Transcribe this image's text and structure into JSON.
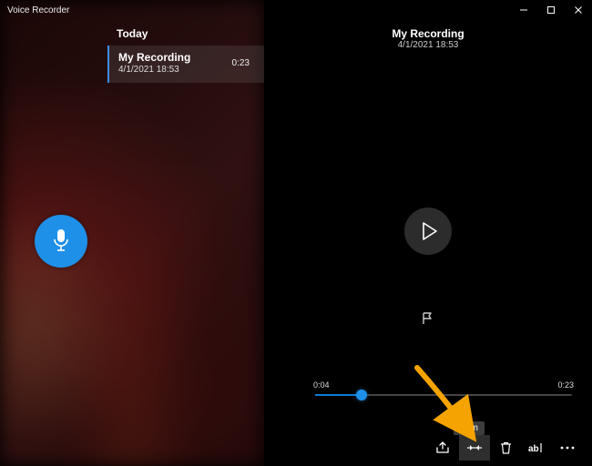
{
  "app": {
    "title": "Voice Recorder"
  },
  "window_controls": {
    "minimize_icon": "minimize-icon",
    "maximize_icon": "maximize-icon",
    "close_icon": "close-icon"
  },
  "colors": {
    "accent": "#1e90e8"
  },
  "list": {
    "section_header": "Today",
    "items": [
      {
        "title": "My Recording",
        "subtitle": "4/1/2021 18:53",
        "duration": "0:23",
        "selected": true
      }
    ]
  },
  "detail": {
    "title": "My Recording",
    "subtitle": "4/1/2021 18:53"
  },
  "timeline": {
    "current": "0:04",
    "total": "0:23",
    "progress_percent": 18
  },
  "toolbar": {
    "share_label": "Share",
    "trim_label": "Trim",
    "delete_label": "Delete",
    "rename_label": "Rename",
    "more_label": "More",
    "tooltip_text": "Trim"
  },
  "record": {
    "icon": "microphone-icon"
  },
  "playback": {
    "play_icon": "play-icon",
    "flag_icon": "flag-icon"
  }
}
